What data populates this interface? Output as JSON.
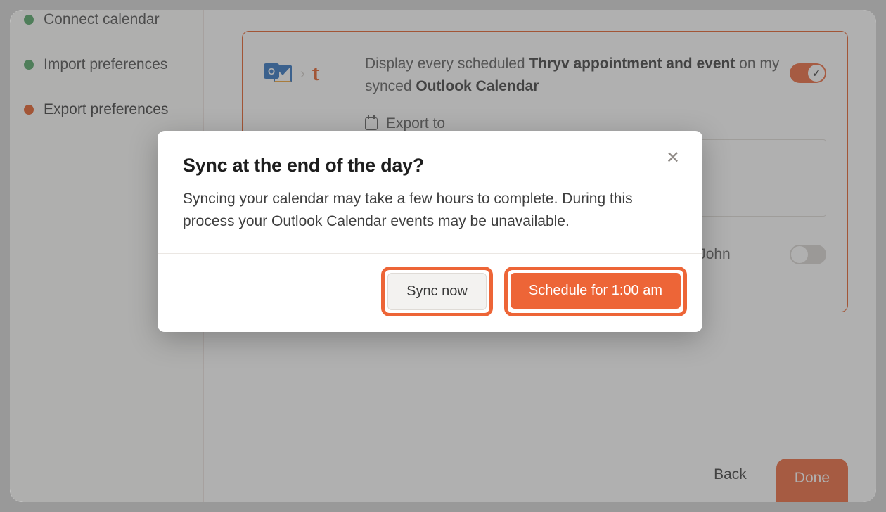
{
  "sidebar": {
    "steps": [
      {
        "label": "Connect calendar",
        "state": "done"
      },
      {
        "label": "Import preferences",
        "state": "done"
      },
      {
        "label": "Export preferences",
        "state": "active"
      }
    ]
  },
  "card": {
    "desc_prefix": "Display every scheduled ",
    "desc_bold1": "Thryv appointment and event",
    "desc_mid": " on my synced ",
    "desc_bold2": "Outlook Calendar",
    "export_to_label": "Export to",
    "toggle1_on": true,
    "second_option_text_suffix": "ar (e.g., John",
    "toggle2_on": false
  },
  "footer": {
    "back_label": "Back",
    "done_label": "Done"
  },
  "modal": {
    "title": "Sync at the end of the day?",
    "body": "Syncing your calendar may take a few hours to complete. During this process your Outlook Calendar events may be unavailable.",
    "sync_now_label": "Sync now",
    "schedule_label": "Schedule for 1:00 am"
  },
  "icons": {
    "outlook_letter": "O",
    "arrow": "›",
    "thryv": "t"
  }
}
